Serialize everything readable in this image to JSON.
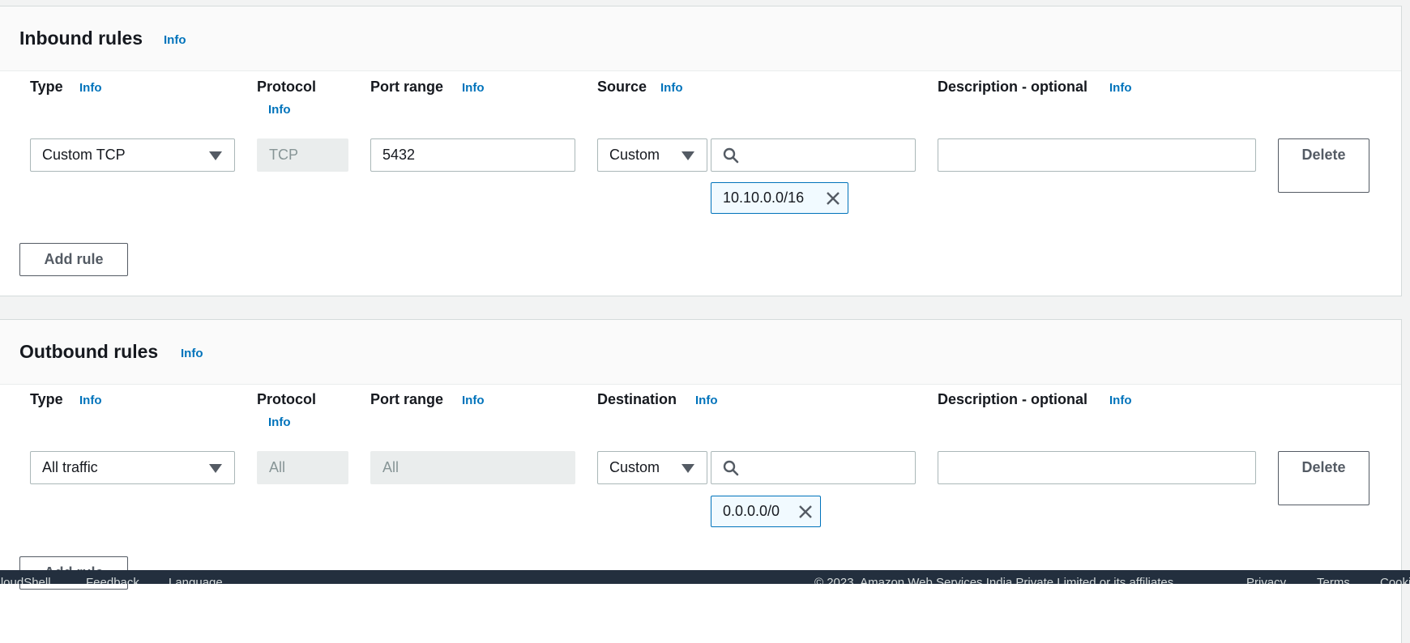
{
  "inbound": {
    "title": "Inbound rules",
    "title_info": "Info",
    "headers": {
      "type": "Type",
      "type_info": "Info",
      "protocol": "Protocol",
      "protocol_info": "Info",
      "port_range": "Port range",
      "port_range_info": "Info",
      "source": "Source",
      "source_info": "Info",
      "description": "Description - optional",
      "description_info": "Info"
    },
    "rule": {
      "type_value": "Custom TCP",
      "protocol_value": "TCP",
      "port_range_value": "5432",
      "source_select": "Custom",
      "search_value": "",
      "token": "10.10.0.0/16",
      "description_value": "",
      "delete_label": "Delete"
    },
    "add_rule_label": "Add rule"
  },
  "outbound": {
    "title": "Outbound rules",
    "title_info": "Info",
    "headers": {
      "type": "Type",
      "type_info": "Info",
      "protocol": "Protocol",
      "protocol_info": "Info",
      "port_range": "Port range",
      "port_range_info": "Info",
      "destination": "Destination",
      "destination_info": "Info",
      "description": "Description - optional",
      "description_info": "Info"
    },
    "rule": {
      "type_value": "All traffic",
      "protocol_value": "All",
      "port_range_value": "All",
      "destination_select": "Custom",
      "search_value": "",
      "token": "0.0.0.0/0",
      "description_value": "",
      "delete_label": "Delete"
    },
    "add_rule_label": "Add rule"
  },
  "footer": {
    "cloudshell": "CloudShell",
    "feedback": "Feedback",
    "language": "Language",
    "copyright": "© 2023, Amazon Web Services India Private Limited or its affiliates.",
    "privacy": "Privacy",
    "terms": "Terms",
    "cookie": "Cookie preferences"
  },
  "colors": {
    "link": "#0073bb",
    "footer_bg": "#232f3e",
    "page_bg": "#f2f3f3"
  }
}
